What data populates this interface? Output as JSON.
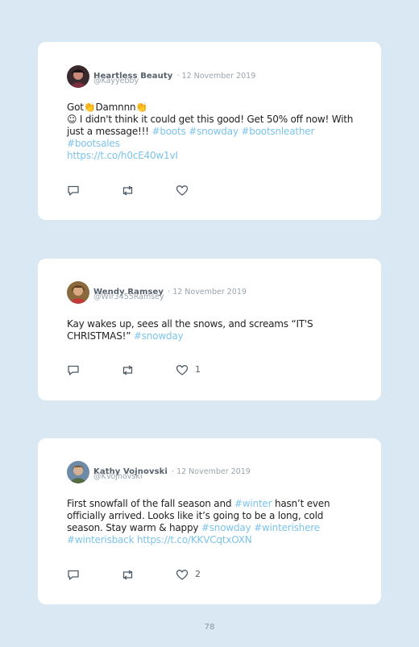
{
  "tweets": [
    {
      "name": "Heartless Beauty",
      "date": "· 12 November 2019",
      "handle": "@Kayyebby",
      "line1": "Got👏Damnnn👏",
      "line2a": "☺ I didn't think it could get this good! Get 50% off now! With",
      "line3a": "just a message!!! ",
      "tag1": "#boots",
      "tag2": "#snowday",
      "tag3": "#bootsnleather",
      "tag4": "#bootsales",
      "link": "https://t.co/h0cE40w1vI"
    },
    {
      "name": "Wendy Ramsey",
      "date": "· 12 November 2019",
      "handle": "@WIr3455Ramsey",
      "line1": "Kay wakes up, sees all the snows, and screams “IT'S",
      "line2a": "CHRISTMAS!” ",
      "tag1": "#snowday",
      "likes": "1"
    },
    {
      "name": "Kathy Vojnovski",
      "date": "· 12 November 2019",
      "handle": "@KVojnovski",
      "line1a": "First snowfall of the fall season and ",
      "tag1": "#winter",
      "line1b": " hasn’t even",
      "line2": "officially arrived. Looks like it’s going to be a long, cold",
      "line3a": "season. Stay warm & happy ",
      "tag2": "#snowday",
      "tag3": "#winterishere",
      "tag4": "#winterisback",
      "link": "https://t.co/KKVCqtxOXN",
      "likes": "2"
    }
  ],
  "page_number": "78",
  "icons": [
    "reply-icon",
    "retweet-icon",
    "like-icon"
  ],
  "colors": {
    "background": "#d9e8f3",
    "hashtag": "#7cc4ea",
    "card": "#ffffff"
  }
}
